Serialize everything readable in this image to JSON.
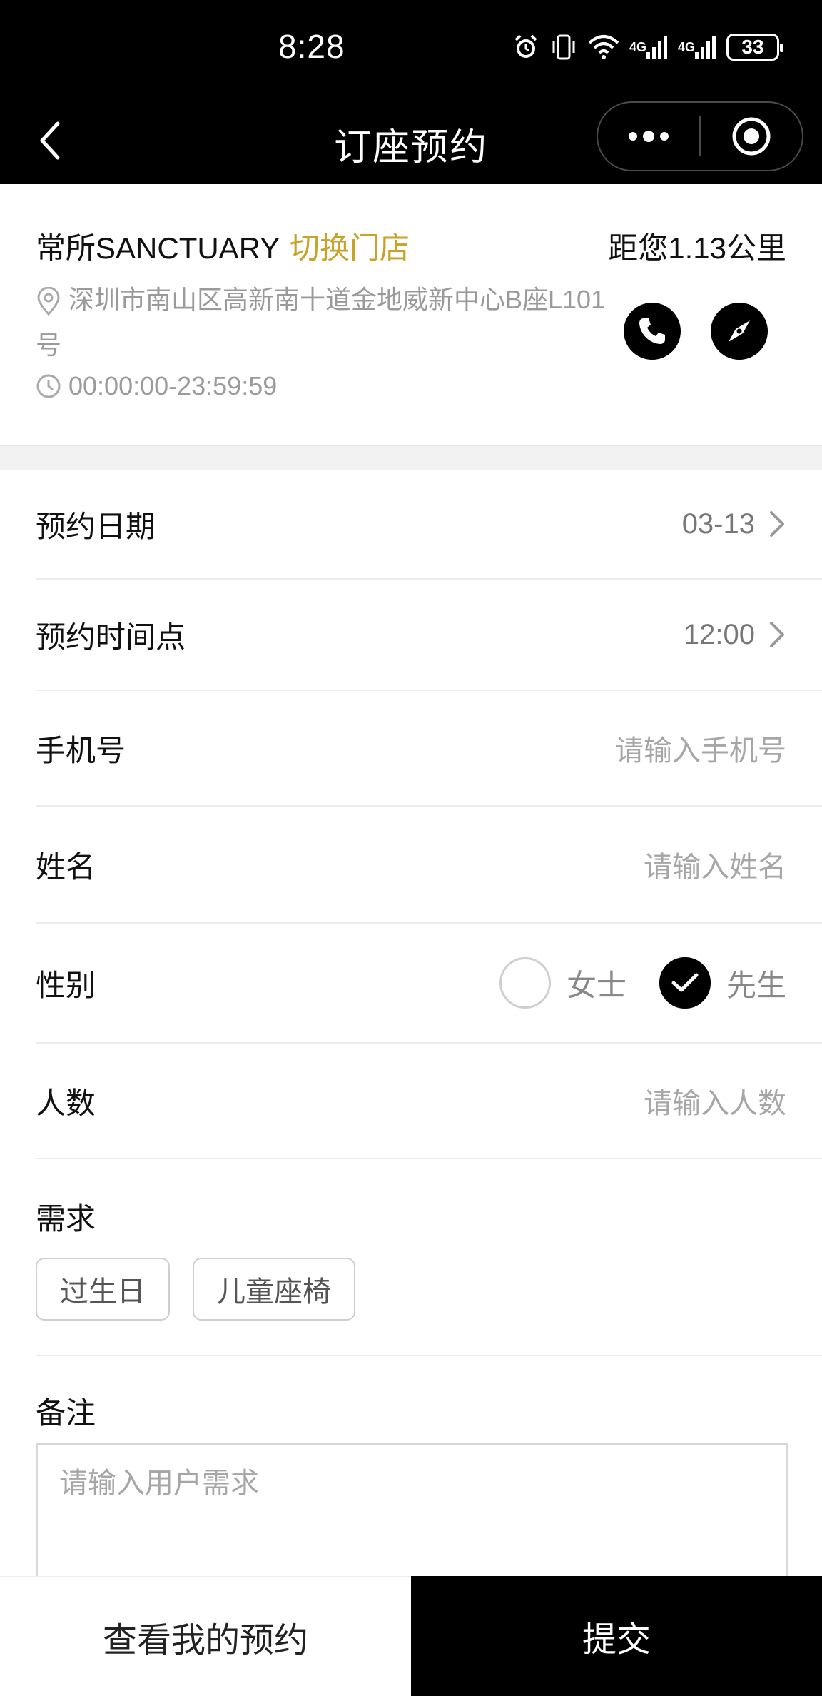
{
  "status_bar": {
    "time": "8:28",
    "battery": "33",
    "net1": "4G",
    "net2": "4G"
  },
  "nav": {
    "title": "订座预约",
    "back_icon": "chevron-left-icon",
    "more_icon": "more-dots-icon",
    "close_icon": "target-circle-icon"
  },
  "store": {
    "name": "常所SANCTUARY",
    "switch_label": "切换门店",
    "distance": "距您1.13公里",
    "address": "深圳市南山区高新南十道金地威新中心B座L101号",
    "hours": "00:00:00-23:59:59"
  },
  "form": {
    "date": {
      "label": "预约日期",
      "value": "03-13"
    },
    "time": {
      "label": "预约时间点",
      "value": "12:00"
    },
    "phone": {
      "label": "手机号",
      "placeholder": "请输入手机号"
    },
    "name": {
      "label": "姓名",
      "placeholder": "请输入姓名"
    },
    "gender": {
      "label": "性别",
      "options": [
        {
          "label": "女士",
          "selected": false
        },
        {
          "label": "先生",
          "selected": true
        }
      ]
    },
    "people": {
      "label": "人数",
      "placeholder": "请输入人数"
    },
    "needs": {
      "label": "需求",
      "tags": [
        "过生日",
        "儿童座椅"
      ]
    },
    "remark": {
      "label": "备注",
      "placeholder": "请输入用户需求"
    }
  },
  "bottom": {
    "my_reservations": "查看我的预约",
    "submit": "提交"
  },
  "colors": {
    "accent": "#c9a227",
    "black": "#000000"
  }
}
